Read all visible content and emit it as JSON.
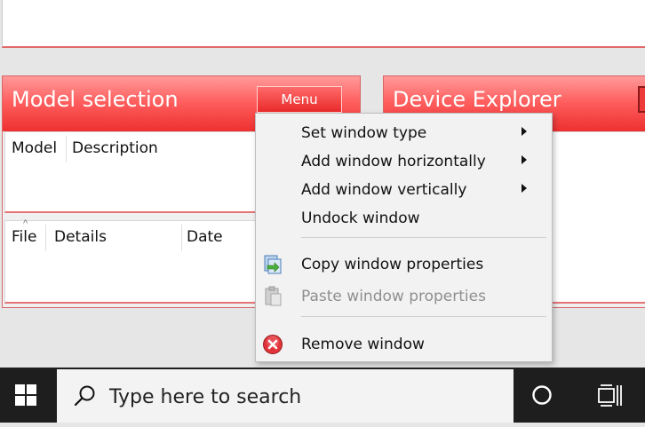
{
  "model_panel": {
    "title": "Model selection",
    "menu_button": "Menu",
    "model_grid": {
      "columns": [
        "Model",
        "Description"
      ]
    },
    "files_grid": {
      "columns": [
        "File",
        "Details",
        "Date"
      ],
      "sort_indicator": "^"
    }
  },
  "device_panel": {
    "title": "Device Explorer"
  },
  "context_menu": {
    "items": [
      {
        "label": "Set window type",
        "submenu": true,
        "enabled": true,
        "icon": ""
      },
      {
        "label": "Add window horizontally",
        "submenu": true,
        "enabled": true,
        "icon": ""
      },
      {
        "label": "Add window vertically",
        "submenu": true,
        "enabled": true,
        "icon": ""
      },
      {
        "label": "Undock window",
        "submenu": false,
        "enabled": true,
        "icon": ""
      },
      {
        "label": "Copy window properties",
        "submenu": false,
        "enabled": true,
        "icon": "copy-icon"
      },
      {
        "label": "Paste window properties",
        "submenu": false,
        "enabled": false,
        "icon": "paste-icon"
      },
      {
        "label": "Remove window",
        "submenu": false,
        "enabled": true,
        "icon": "remove-icon"
      }
    ]
  },
  "taskbar": {
    "search_placeholder": "Type here to search",
    "start_icon": "windows-logo-icon",
    "cortana_icon": "cortana-circle-icon",
    "taskview_icon": "task-view-icon"
  },
  "colors": {
    "panel_red": "#ee2f2f",
    "panel_border": "#d96565",
    "taskbar": "#1e1e1e",
    "menu_bg": "#f2f2f2"
  }
}
